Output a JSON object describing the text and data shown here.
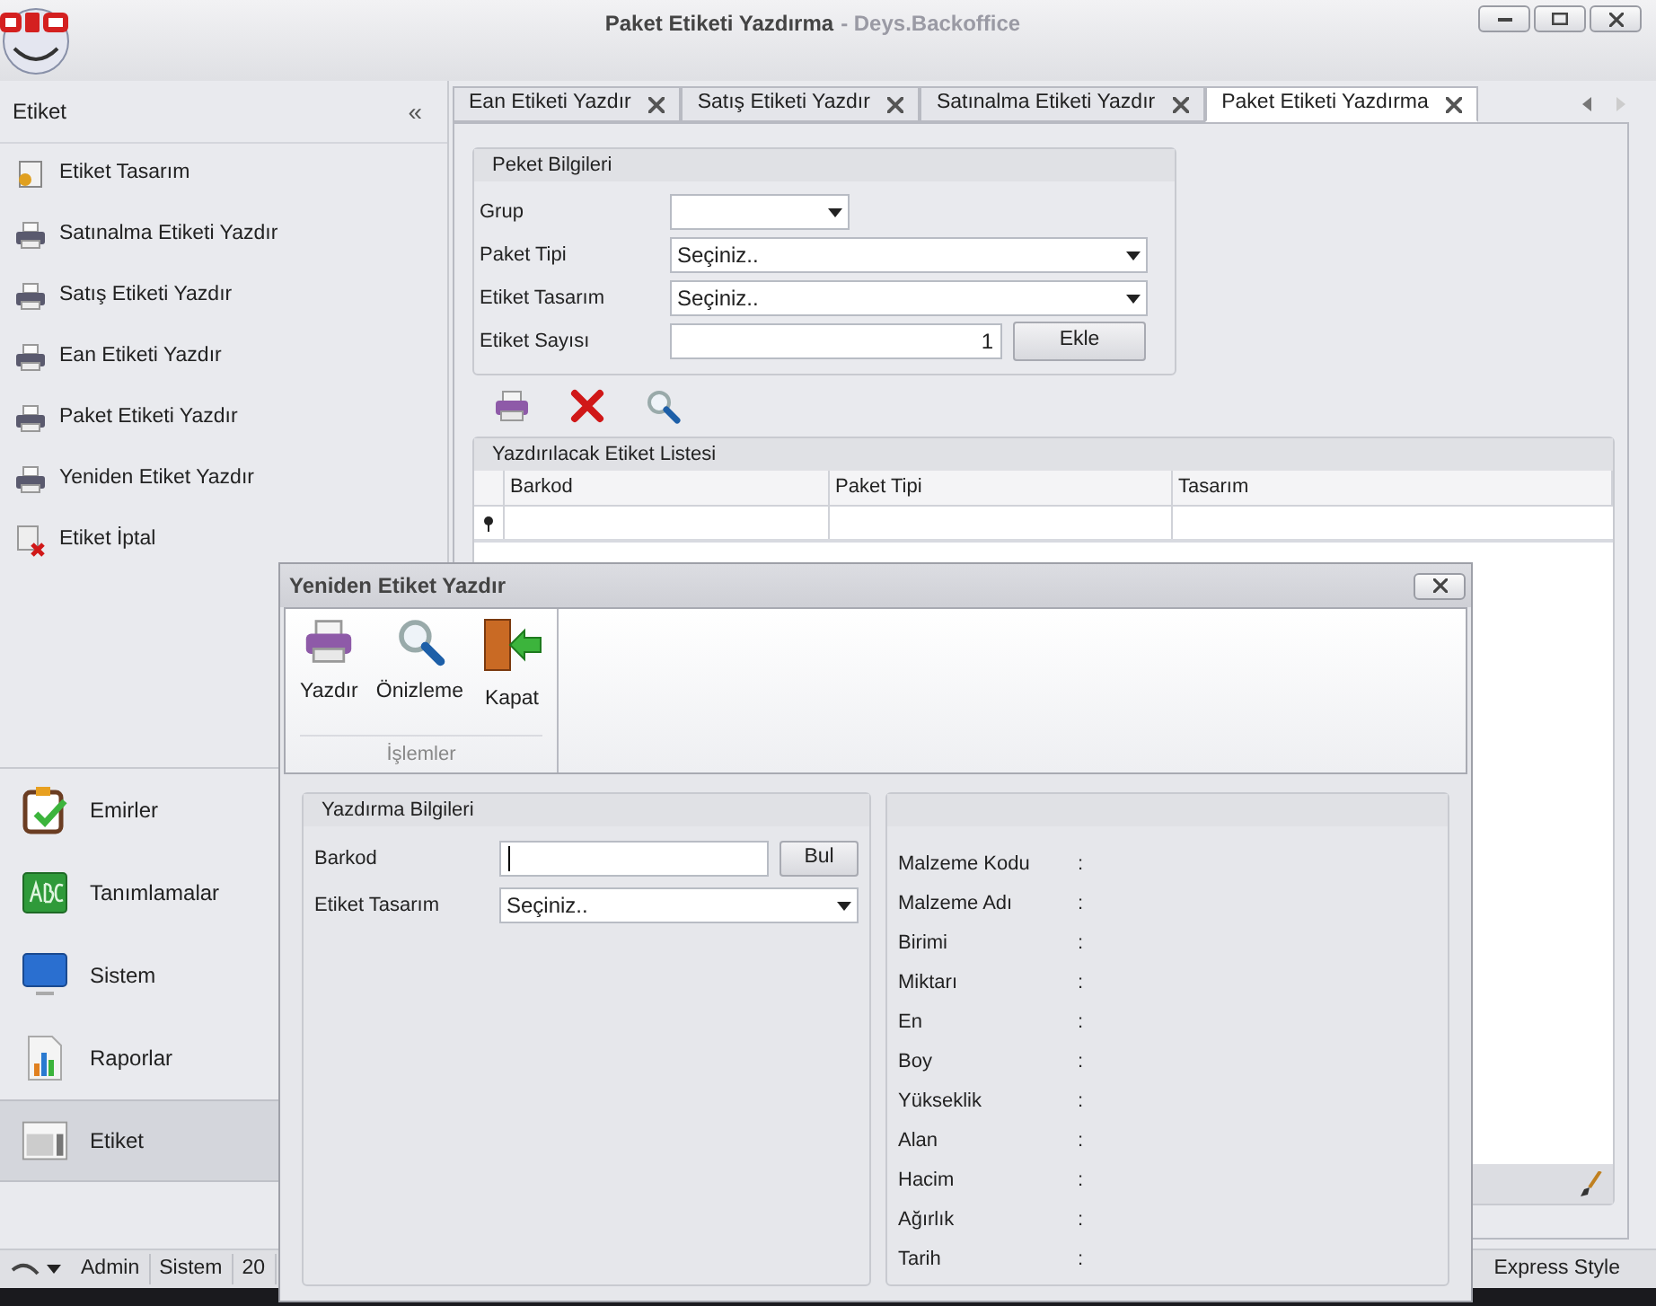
{
  "window": {
    "title": "Paket Etiketi Yazdırma",
    "subtitle": "- Deys.Backoffice"
  },
  "sidebar": {
    "header": "Etiket",
    "collapse": "«",
    "items": [
      {
        "label": "Etiket Tasarım",
        "kind": "design"
      },
      {
        "label": "Satınalma Etiketi Yazdır",
        "kind": "print"
      },
      {
        "label": "Satış Etiketi Yazdır",
        "kind": "print"
      },
      {
        "label": "Ean Etiketi Yazdır",
        "kind": "print"
      },
      {
        "label": "Paket Etiketi Yazdır",
        "kind": "print"
      },
      {
        "label": "Yeniden Etiket Yazdır",
        "kind": "print"
      },
      {
        "label": "Etiket İptal",
        "kind": "cancel"
      }
    ],
    "groups": [
      {
        "label": "Emirler",
        "kind": "orders",
        "selected": false
      },
      {
        "label": "Tanımlamalar",
        "kind": "definitions",
        "selected": false
      },
      {
        "label": "Sistem",
        "kind": "system",
        "selected": false
      },
      {
        "label": "Raporlar",
        "kind": "reports",
        "selected": false
      },
      {
        "label": "Etiket",
        "kind": "label",
        "selected": true
      }
    ]
  },
  "tabs": [
    {
      "label": "Ean Etiketi Yazdır",
      "selected": false
    },
    {
      "label": "Satış Etiketi Yazdır",
      "selected": false
    },
    {
      "label": "Satınalma Etiketi Yazdır",
      "selected": false
    },
    {
      "label": "Paket Etiketi Yazdırma",
      "selected": true
    }
  ],
  "package_info": {
    "title": "Peket Bilgileri",
    "fields": [
      {
        "label": "Grup",
        "kind": "combo_small"
      },
      {
        "label": "Paket Tipi",
        "kind": "combo",
        "value": "Seçiniz.."
      },
      {
        "label": "Etiket Tasarım",
        "kind": "combo",
        "value": "Seçiniz.."
      },
      {
        "label": "Etiket Sayısı",
        "kind": "number",
        "value": "1"
      }
    ],
    "button": "Ekle"
  },
  "label_list": {
    "title": "Yazdırılacak Etiket Listesi",
    "columns": [
      "Barkod",
      "Paket Tipi",
      "Tasarım"
    ]
  },
  "status_bar": {
    "items": [
      "Admin",
      "Sistem",
      "20"
    ],
    "style": "Express Style"
  },
  "dialog": {
    "title": "Yeniden Etiket Yazdır",
    "ribbon": {
      "buttons": [
        {
          "label": "Yazdır",
          "kind": "print"
        },
        {
          "label": "Önizleme",
          "kind": "preview"
        },
        {
          "label": "Kapat",
          "kind": "close"
        }
      ],
      "group": "İşlemler"
    },
    "print_info": {
      "title": "Yazdırma Bilgileri",
      "fields": [
        {
          "label": "Barkod",
          "kind": "text"
        },
        {
          "label": "Etiket Tasarım",
          "kind": "combo",
          "value": "Seçiniz.."
        }
      ],
      "button": "Bul"
    },
    "details": [
      {
        "label": "Malzeme Kodu",
        "colon": ":"
      },
      {
        "label": "Malzeme Adı",
        "colon": ":"
      },
      {
        "label": "Birimi",
        "colon": ":"
      },
      {
        "label": "Miktarı",
        "colon": ":"
      },
      {
        "label": "En",
        "colon": ":"
      },
      {
        "label": "Boy",
        "colon": ":"
      },
      {
        "label": "Yükseklik",
        "colon": ":"
      },
      {
        "label": "Alan",
        "colon": ":"
      },
      {
        "label": "Hacim",
        "colon": ":"
      },
      {
        "label": "Ağırlık",
        "colon": ":"
      },
      {
        "label": "Tarih",
        "colon": ":"
      }
    ]
  }
}
